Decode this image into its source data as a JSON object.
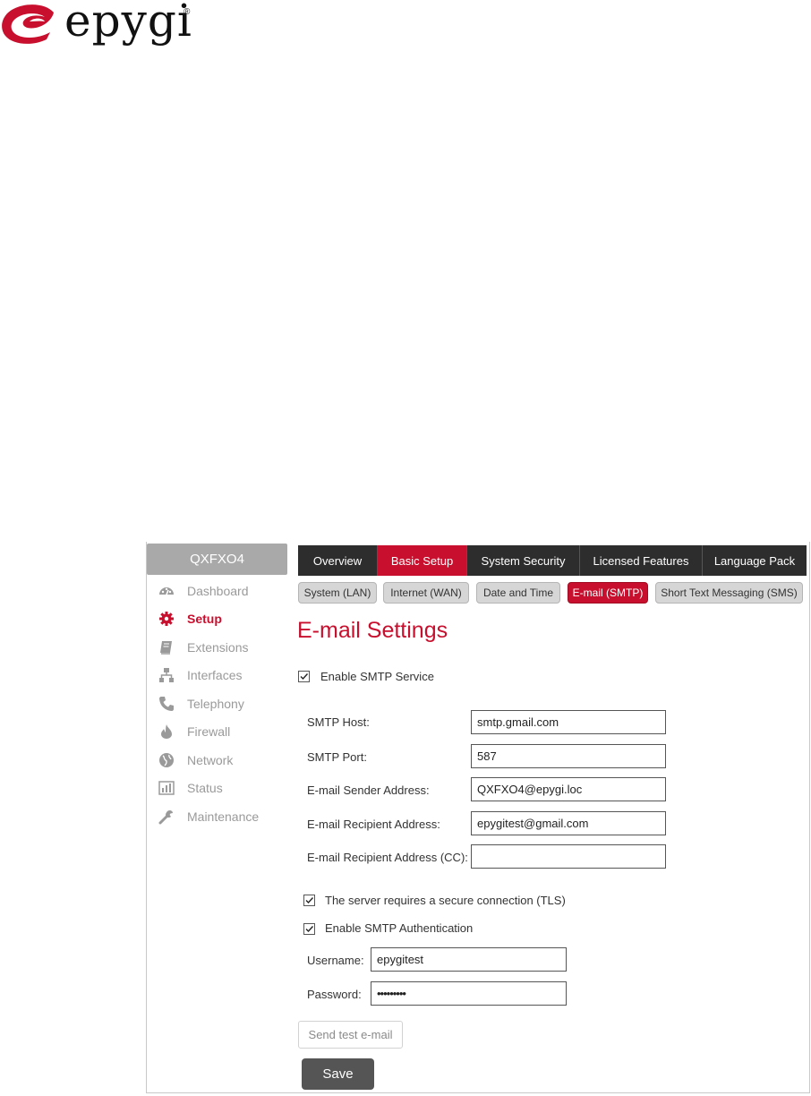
{
  "brand": {
    "name": "epygi",
    "registered": "®",
    "accent": "#c8102e"
  },
  "device": "QXFXO4",
  "sidebar": {
    "items": [
      {
        "label": "Dashboard",
        "icon": "dashboard-icon",
        "active": false
      },
      {
        "label": "Setup",
        "icon": "gear-icon",
        "active": true
      },
      {
        "label": "Extensions",
        "icon": "book-icon",
        "active": false
      },
      {
        "label": "Interfaces",
        "icon": "sitemap-icon",
        "active": false
      },
      {
        "label": "Telephony",
        "icon": "phone-icon",
        "active": false
      },
      {
        "label": "Firewall",
        "icon": "fire-icon",
        "active": false
      },
      {
        "label": "Network",
        "icon": "globe-icon",
        "active": false
      },
      {
        "label": "Status",
        "icon": "bar-chart-icon",
        "active": false
      },
      {
        "label": "Maintenance",
        "icon": "wrench-icon",
        "active": false
      }
    ]
  },
  "topnav": {
    "tabs": [
      {
        "label": "Overview",
        "active": false
      },
      {
        "label": "Basic Setup",
        "active": true
      },
      {
        "label": "System Security",
        "active": false
      },
      {
        "label": "Licensed Features",
        "active": false
      },
      {
        "label": "Language Pack",
        "active": false
      }
    ]
  },
  "subnav": {
    "tabs": [
      {
        "label": "System (LAN)",
        "active": false
      },
      {
        "label": "Internet (WAN)",
        "active": false
      },
      {
        "label": "Date and Time",
        "active": false
      },
      {
        "label": "E-mail (SMTP)",
        "active": true
      },
      {
        "label": "Short Text Messaging (SMS)",
        "active": false
      }
    ]
  },
  "page": {
    "title": "E-mail Settings"
  },
  "form": {
    "enable_smtp": {
      "label": "Enable SMTP Service",
      "checked": true
    },
    "smtp_host": {
      "label": "SMTP Host:",
      "value": "smtp.gmail.com"
    },
    "smtp_port": {
      "label": "SMTP Port:",
      "value": "587"
    },
    "sender": {
      "label": "E-mail Sender Address:",
      "value": "QXFXO4@epygi.loc"
    },
    "recipient": {
      "label": "E-mail Recipient Address:",
      "value": "epygitest@gmail.com"
    },
    "recipient_cc": {
      "label": "E-mail Recipient Address (CC):",
      "value": ""
    },
    "tls": {
      "label": "The server requires a secure connection (TLS)",
      "checked": true
    },
    "auth": {
      "label": "Enable SMTP Authentication",
      "checked": true
    },
    "username": {
      "label": "Username:",
      "value": "epygitest"
    },
    "password": {
      "label": "Password:",
      "value": "•••••••••"
    }
  },
  "buttons": {
    "send_test": "Send test e-mail",
    "save": "Save"
  }
}
